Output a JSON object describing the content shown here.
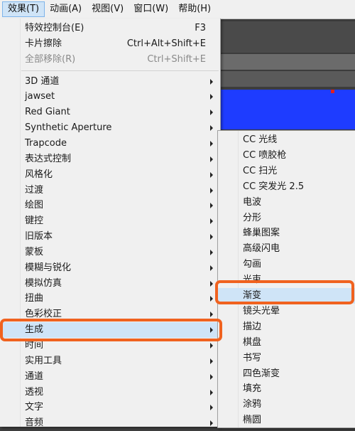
{
  "menubar": {
    "items": [
      {
        "label": "效果(T)",
        "active": true
      },
      {
        "label": "动画(A)"
      },
      {
        "label": "视图(V)"
      },
      {
        "label": "窗口(W)"
      },
      {
        "label": "帮助(H)"
      }
    ]
  },
  "effects_menu": {
    "top_items": [
      {
        "label": "特效控制台(E)",
        "shortcut": "F3"
      },
      {
        "label": "卡片擦除",
        "shortcut": "Ctrl+Alt+Shift+E"
      },
      {
        "label": "全部移除(R)",
        "shortcut": "Ctrl+Shift+E",
        "disabled": true
      }
    ],
    "categories": [
      "3D 通道",
      "jawset",
      "Red Giant",
      "Synthetic Aperture",
      "Trapcode",
      "表达式控制",
      "风格化",
      "过渡",
      "绘图",
      "键控",
      "旧版本",
      "蒙板",
      "模糊与锐化",
      "模拟仿真",
      "扭曲",
      "色彩校正",
      "生成",
      "时间",
      "实用工具",
      "通道",
      "透视",
      "文字",
      "音频"
    ],
    "highlighted": "生成"
  },
  "generate_submenu": {
    "items": [
      "CC 光线",
      "CC 喷胶枪",
      "CC 扫光",
      "CC 突发光 2.5",
      "电波",
      "分形",
      "蜂巢图案",
      "高级闪电",
      "勾画",
      "光束",
      "渐变",
      "镜头光晕",
      "描边",
      "棋盘",
      "书写",
      "四色渐变",
      "填充",
      "涂鸦",
      "椭圆"
    ],
    "highlighted": "渐变"
  },
  "colors": {
    "annotation": "#f0621f",
    "menu_bg": "#f0f0f0",
    "highlight": "#cfe4f7",
    "canvas_blue": "#1e3cff"
  }
}
